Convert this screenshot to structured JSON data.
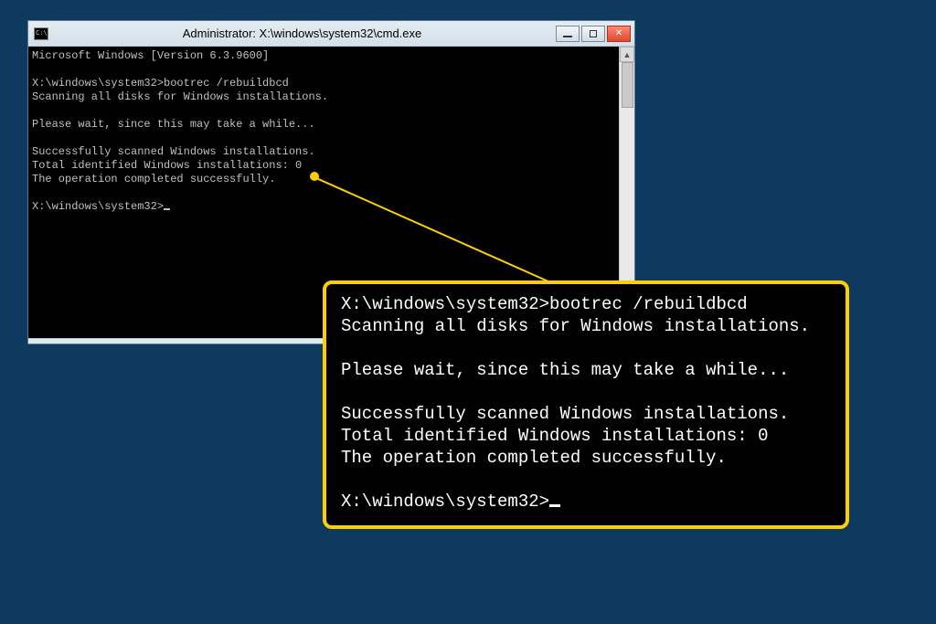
{
  "window": {
    "title": "Administrator: X:\\windows\\system32\\cmd.exe"
  },
  "terminal": {
    "lines": [
      "Microsoft Windows [Version 6.3.9600]",
      "",
      "X:\\windows\\system32>bootrec /rebuildbcd",
      "Scanning all disks for Windows installations.",
      "",
      "Please wait, since this may take a while...",
      "",
      "Successfully scanned Windows installations.",
      "Total identified Windows installations: 0",
      "The operation completed successfully."
    ],
    "prompt": "X:\\windows\\system32>"
  },
  "zoom": {
    "lines": [
      "X:\\windows\\system32>bootrec /rebuildbcd",
      "Scanning all disks for Windows installations.",
      "",
      "Please wait, since this may take a while...",
      "",
      "Successfully scanned Windows installations.",
      "Total identified Windows installations: 0",
      "The operation completed successfully."
    ],
    "prompt": "X:\\windows\\system32>"
  }
}
